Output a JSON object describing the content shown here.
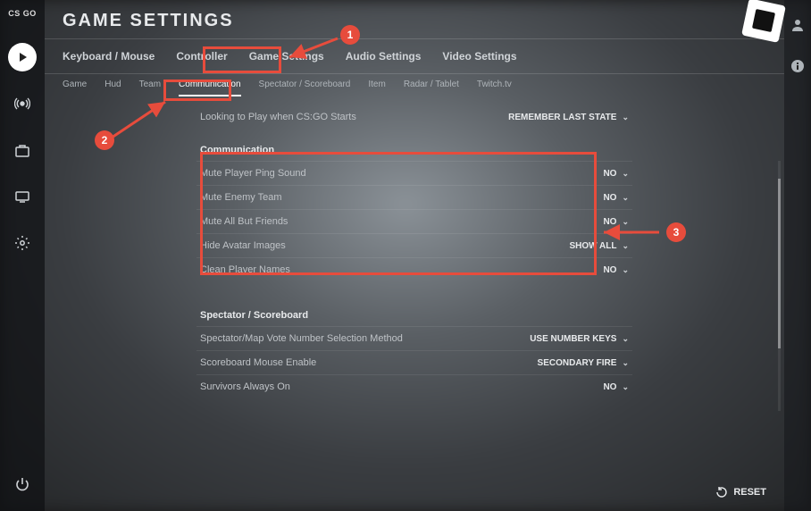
{
  "logo": "CS  GO",
  "pageTitle": "GAME SETTINGS",
  "tabs1": [
    "Keyboard / Mouse",
    "Controller",
    "Game Settings",
    "Audio Settings",
    "Video Settings"
  ],
  "tabs2": [
    "Game",
    "Hud",
    "Team",
    "Communication",
    "Spectator / Scoreboard",
    "Item",
    "Radar / Tablet",
    "Twitch.tv"
  ],
  "tabs2Active": 3,
  "topRow": {
    "label": "Looking to Play when CS:GO Starts",
    "value": "REMEMBER LAST STATE"
  },
  "sections": [
    {
      "heading": "Communication",
      "rows": [
        {
          "label": "Mute Player Ping Sound",
          "value": "NO"
        },
        {
          "label": "Mute Enemy Team",
          "value": "NO"
        },
        {
          "label": "Mute All But Friends",
          "value": "NO"
        },
        {
          "label": "Hide Avatar Images",
          "value": "SHOW ALL"
        },
        {
          "label": "Clean Player Names",
          "value": "NO"
        }
      ]
    },
    {
      "heading": "Spectator / Scoreboard",
      "rows": [
        {
          "label": "Spectator/Map Vote Number Selection Method",
          "value": "USE NUMBER KEYS"
        },
        {
          "label": "Scoreboard Mouse Enable",
          "value": "SECONDARY FIRE"
        },
        {
          "label": "Survivors Always On",
          "value": "NO"
        }
      ]
    }
  ],
  "reset": "RESET",
  "annotations": {
    "n1": "1",
    "n2": "2",
    "n3": "3"
  }
}
